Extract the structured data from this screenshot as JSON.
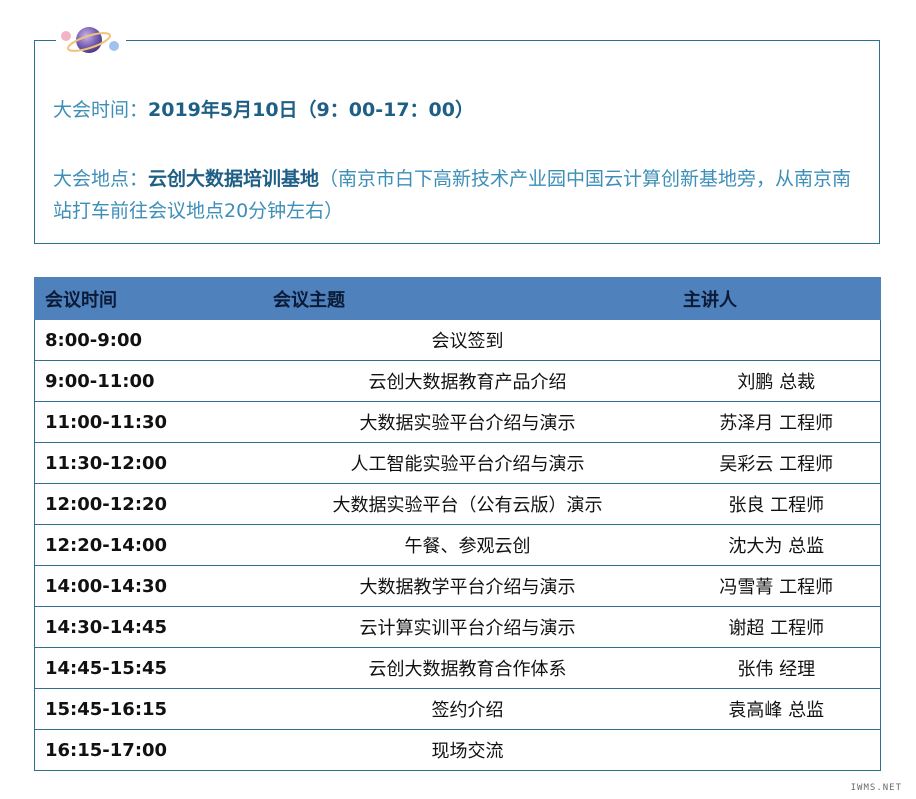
{
  "info": {
    "time_label": "大会时间：",
    "time_value": "2019年5月10日（9：00-17：00）",
    "place_label": "大会地点：",
    "place_value": "云创大数据培训基地",
    "place_detail": "（南京市白下高新技术产业园中国云计算创新基地旁，从南京南站打车前往会议地点20分钟左右）"
  },
  "table": {
    "headers": {
      "time": "会议时间",
      "topic": "会议主题",
      "speaker": "主讲人"
    },
    "rows": [
      {
        "time": "8:00-9:00",
        "topic": "会议签到",
        "speaker": ""
      },
      {
        "time": "9:00-11:00",
        "topic": "云创大数据教育产品介绍",
        "speaker": "刘鹏 总裁"
      },
      {
        "time": "11:00-11:30",
        "topic": "大数据实验平台介绍与演示",
        "speaker": "苏泽月 工程师"
      },
      {
        "time": "11:30-12:00",
        "topic": "人工智能实验平台介绍与演示",
        "speaker": "吴彩云 工程师"
      },
      {
        "time": "12:00-12:20",
        "topic": "大数据实验平台（公有云版）演示",
        "speaker": "张良 工程师"
      },
      {
        "time": "12:20-14:00",
        "topic": "午餐、参观云创",
        "speaker": "沈大为 总监"
      },
      {
        "time": "14:00-14:30",
        "topic": "大数据教学平台介绍与演示",
        "speaker": "冯雪菁 工程师"
      },
      {
        "time": "14:30-14:45",
        "topic": "云计算实训平台介绍与演示",
        "speaker": "谢超 工程师"
      },
      {
        "time": "14:45-15:45",
        "topic": "云创大数据教育合作体系",
        "speaker": "张伟 经理"
      },
      {
        "time": "15:45-16:15",
        "topic": "签约介绍",
        "speaker": "袁高峰 总监"
      },
      {
        "time": "16:15-17:00",
        "topic": "现场交流",
        "speaker": ""
      }
    ]
  },
  "watermark": "IWMS.NET",
  "decoration": {
    "icon": "planet-icon"
  },
  "colors": {
    "accent": "#3d8fb8",
    "highlight": "#1f5f86",
    "header_bg": "#4f81bd",
    "border": "#2f6f8f"
  }
}
